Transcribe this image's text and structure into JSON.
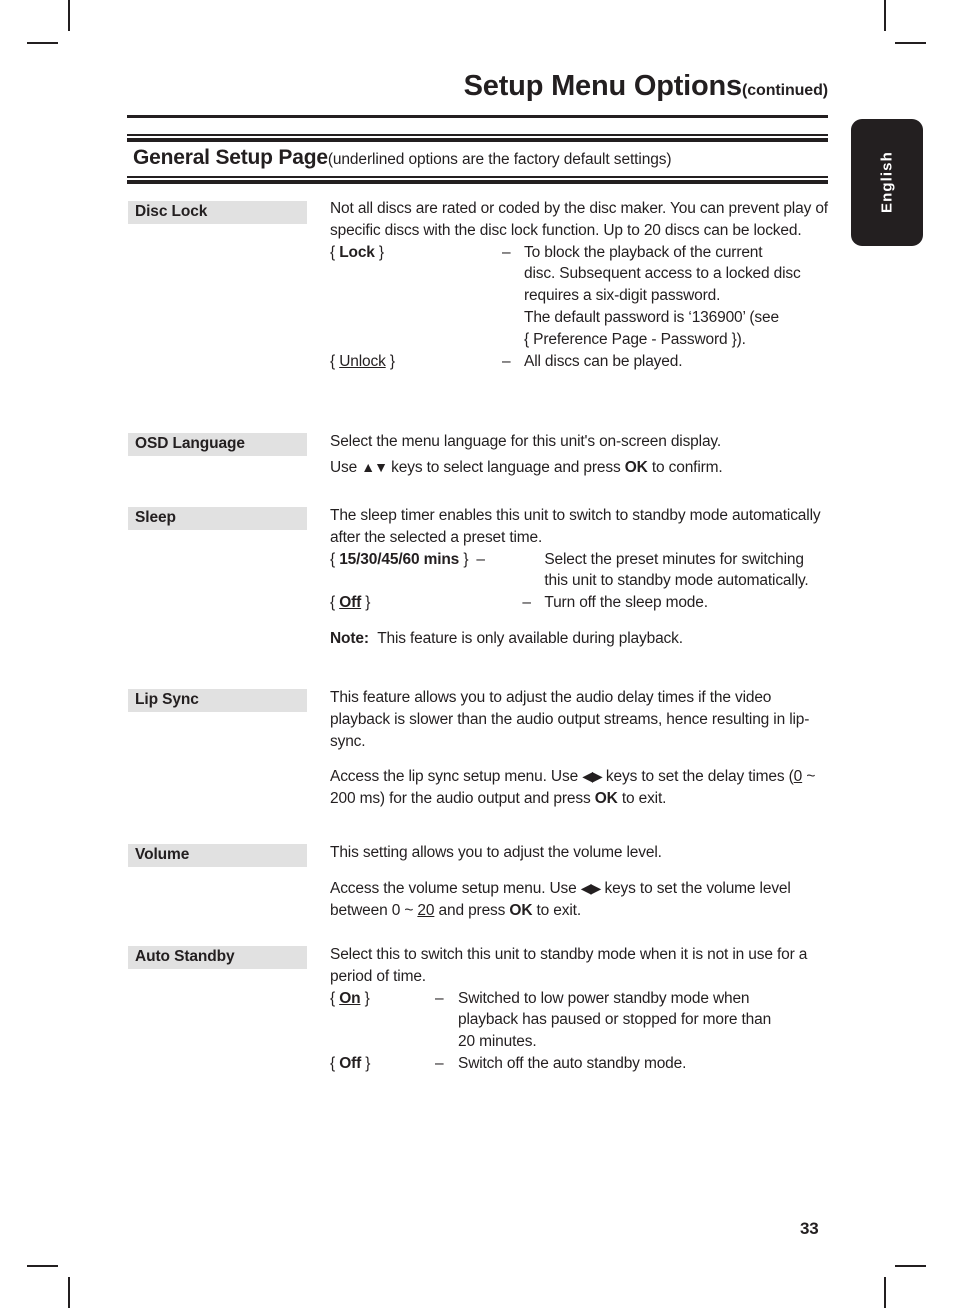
{
  "header": {
    "running_title": "Setup Menu Options",
    "running_title_suffix": "(continued)",
    "section_title": "General Setup Page",
    "section_subtitle": "(underlined options are the factory default settings)"
  },
  "sidebar": {
    "language_tab": "English"
  },
  "footer": {
    "page_number": "33"
  },
  "colors": {
    "ink": "#231f20",
    "label_background": "#e1e1e1",
    "tab_background": "#231f20",
    "tab_text": "#ffffff"
  },
  "settings": [
    {
      "label": "Disc Lock",
      "intro": "Not all discs are rated or coded by the disc maker. You can prevent play of specific discs with the disc lock function. Up to 20 discs can be locked.",
      "options": [
        {
          "name": "Lock",
          "bold": true,
          "underline": false,
          "dash": "–",
          "description": "To block the playback of the current disc. Subsequent access to a locked disc requires a six-digit password.\nThe default password is ‘136900’ (see { Preference Page - Password }).",
          "desc_line_1": "To block the playback of the current",
          "desc_line_2": "disc. Subsequent access to a locked disc",
          "desc_line_3": "requires a six-digit password.",
          "desc_line_4": "The default password is ‘136900’ (see",
          "desc_line_5": "{ Preference Page - Password })."
        },
        {
          "name": "Unlock",
          "bold": false,
          "underline": true,
          "dash": "–",
          "description": "All discs can be played."
        }
      ]
    },
    {
      "label": "OSD Language",
      "intro": "Select the menu language for this unit's on-screen display.",
      "instruction_prefix": "Use ",
      "instruction_arrows": "▲▼",
      "instruction_middle": " keys to select language and press ",
      "instruction_key": "OK",
      "instruction_suffix": " to confirm."
    },
    {
      "label": "Sleep",
      "intro": "The sleep timer enables this unit to switch to standby mode automatically after the selected a preset time.",
      "options": [
        {
          "name": "15/30/45/60 mins",
          "bold": true,
          "underline": false,
          "dash": "–",
          "desc_line_1": "Select the preset minutes for switching",
          "desc_line_2": "this unit to standby mode automatically."
        },
        {
          "name": "Off",
          "bold": true,
          "underline": true,
          "dash": "–",
          "description": "Turn off the sleep mode."
        }
      ],
      "note_label": "Note:",
      "note_text": "This feature is only available during playback."
    },
    {
      "label": "Lip Sync",
      "intro": "This feature allows you to adjust the audio delay times if the video playback is slower than the audio output streams, hence resulting in lip-sync.",
      "access_prefix": "Access the lip sync setup menu. Use ",
      "access_arrows": "◀▶",
      "access_middle": " keys to set the delay times (",
      "access_value": "0",
      "access_middle_2": " ~ 200 ms) for the audio output and press ",
      "access_key": "OK",
      "access_suffix": " to exit."
    },
    {
      "label": "Volume",
      "intro": "This setting allows you to adjust the volume level.",
      "access_prefix": "Access the volume setup menu. Use ",
      "access_arrows": "◀▶",
      "access_middle": " keys to set the volume level between 0 ~ ",
      "access_value": "20",
      "access_middle_2": " and press ",
      "access_key": "OK",
      "access_suffix": " to exit."
    },
    {
      "label": "Auto Standby",
      "intro": "Select this to switch this unit to standby mode when it is not in use for a period of time.",
      "options": [
        {
          "name": "On",
          "bold": true,
          "underline": true,
          "dash": "–",
          "desc_line_1": "Switched to low power standby mode when",
          "desc_line_2": "playback has paused or stopped for more than",
          "desc_line_3": "20 minutes."
        },
        {
          "name": "Off",
          "bold": true,
          "underline": false,
          "dash": "–",
          "description": "Switch off the auto standby mode."
        }
      ]
    }
  ]
}
